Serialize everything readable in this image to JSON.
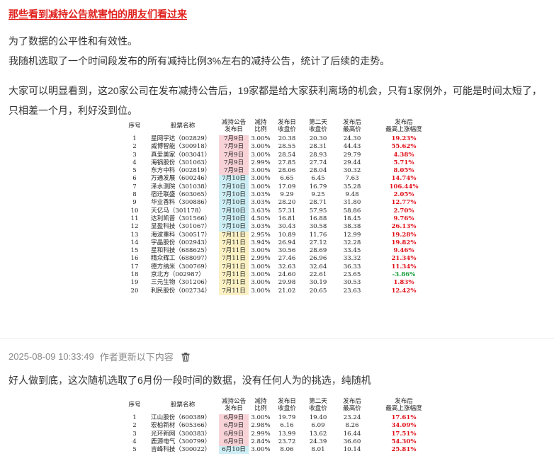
{
  "post": {
    "title": "那些看到减持公告就害怕的朋友们看过来",
    "p1": "为了数据的公平性和有效性。",
    "p2": "我随机选取了一个时间段发布的所有减持比例3%左右的减持公告，统计了后续的走势。",
    "p3": "大家可以明显看到，这20家公司在发布减持公告后，19家都是给大家获利离场的机会，只有1家例外，可能是时间太短了，只相差一个月，利好没到位。"
  },
  "table_headers": {
    "no": "序号",
    "name": "股票名称",
    "date_l1": "减持公告",
    "date_l2": "发布日",
    "ratio_l1": "减持",
    "ratio_l2": "比例",
    "close_l1": "发布日",
    "close_l2": "收盘价",
    "next_l1": "第二天",
    "next_l2": "收盘价",
    "high_l1": "发布后",
    "high_l2": "最高价",
    "pct_l1": "发布后",
    "pct_l2": "最高上涨幅度"
  },
  "table1": [
    {
      "no": "1",
      "name": "星网宇达（002829）",
      "date": "7月9日",
      "ratio": "3.00%",
      "close": "20.38",
      "next": "20.30",
      "high": "24.30",
      "pct": "19.23%",
      "bg": "pink",
      "sign": "pos"
    },
    {
      "no": "2",
      "name": "威博智能（300918）",
      "date": "7月9日",
      "ratio": "3.00%",
      "close": "28.55",
      "next": "28.31",
      "high": "44.43",
      "pct": "55.62%",
      "bg": "pink",
      "sign": "pos"
    },
    {
      "no": "3",
      "name": "真爱美家（003041）",
      "date": "7月9日",
      "ratio": "3.00%",
      "close": "28.54",
      "next": "28.93",
      "high": "29.79",
      "pct": "4.38%",
      "bg": "pink",
      "sign": "pos"
    },
    {
      "no": "4",
      "name": "海锅股份（301063）",
      "date": "7月9日",
      "ratio": "2.99%",
      "close": "27.85",
      "next": "27.74",
      "high": "29.44",
      "pct": "5.71%",
      "bg": "pink",
      "sign": "pos"
    },
    {
      "no": "5",
      "name": "东方中科（002819）",
      "date": "7月9日",
      "ratio": "3.00%",
      "close": "28.06",
      "next": "28.04",
      "high": "30.32",
      "pct": "8.05%",
      "bg": "pink",
      "sign": "pos"
    },
    {
      "no": "6",
      "name": "万通发展（600246）",
      "date": "7月10日",
      "ratio": "3.00%",
      "close": "6.65",
      "next": "6.45",
      "high": "7.63",
      "pct": "14.74%",
      "bg": "cyan",
      "sign": "pos"
    },
    {
      "no": "7",
      "name": "泽水测院（301038）",
      "date": "7月10日",
      "ratio": "3.00%",
      "close": "17.09",
      "next": "16.79",
      "high": "35.28",
      "pct": "106.44%",
      "bg": "cyan",
      "sign": "pos"
    },
    {
      "no": "8",
      "name": "宿迁联盛（603065）",
      "date": "7月10日",
      "ratio": "3.03%",
      "close": "9.29",
      "next": "9.25",
      "high": "9.48",
      "pct": "2.05%",
      "bg": "cyan",
      "sign": "pos"
    },
    {
      "no": "9",
      "name": "华业香料（300886）",
      "date": "7月10日",
      "ratio": "3.03%",
      "close": "28.20",
      "next": "28.71",
      "high": "31.80",
      "pct": "12.77%",
      "bg": "cyan",
      "sign": "pos"
    },
    {
      "no": "10",
      "name": "天亿马（301178）",
      "date": "7月10日",
      "ratio": "3.63%",
      "close": "57.31",
      "next": "57.95",
      "high": "58.86",
      "pct": "2.70%",
      "bg": "cyan",
      "sign": "pos"
    },
    {
      "no": "11",
      "name": "达利凯普（301566）",
      "date": "7月10日",
      "ratio": "4.50%",
      "close": "16.81",
      "next": "16.88",
      "high": "18.45",
      "pct": "9.76%",
      "bg": "cyan",
      "sign": "pos"
    },
    {
      "no": "12",
      "name": "显盈科技（301067）",
      "date": "7月10日",
      "ratio": "3.03%",
      "close": "30.43",
      "next": "30.58",
      "high": "38.38",
      "pct": "26.13%",
      "bg": "cyan",
      "sign": "pos"
    },
    {
      "no": "13",
      "name": "海波重科（300517）",
      "date": "7月11日",
      "ratio": "2.95%",
      "close": "10.89",
      "next": "11.76",
      "high": "12.99",
      "pct": "19.28%",
      "bg": "yellow",
      "sign": "pos"
    },
    {
      "no": "14",
      "name": "宇晶股份（002943）",
      "date": "7月11日",
      "ratio": "3.94%",
      "close": "26.94",
      "next": "27.12",
      "high": "32.28",
      "pct": "19.82%",
      "bg": "yellow",
      "sign": "pos"
    },
    {
      "no": "15",
      "name": "星和科技（688625）",
      "date": "7月11日",
      "ratio": "3.00%",
      "close": "30.56",
      "next": "28.69",
      "high": "33.45",
      "pct": "9.46%",
      "bg": "yellow",
      "sign": "pos"
    },
    {
      "no": "16",
      "name": "精众辉工（688097）",
      "date": "7月11日",
      "ratio": "2.99%",
      "close": "27.46",
      "next": "26.96",
      "high": "33.32",
      "pct": "21.34%",
      "bg": "yellow",
      "sign": "pos"
    },
    {
      "no": "17",
      "name": "德方纳米（300769）",
      "date": "7月11日",
      "ratio": "3.00%",
      "close": "32.63",
      "next": "32.64",
      "high": "36.33",
      "pct": "11.34%",
      "bg": "yellow",
      "sign": "pos"
    },
    {
      "no": "18",
      "name": "京北方（002987）",
      "date": "7月11日",
      "ratio": "3.00%",
      "close": "24.60",
      "next": "22.61",
      "high": "23.65",
      "pct": "-3.86%",
      "bg": "yellow",
      "sign": "neg"
    },
    {
      "no": "19",
      "name": "三元生物（301206）",
      "date": "7月11日",
      "ratio": "3.00%",
      "close": "29.98",
      "next": "30.19",
      "high": "30.53",
      "pct": "1.83%",
      "bg": "yellow",
      "sign": "pos"
    },
    {
      "no": "20",
      "name": "利民股份（002734）",
      "date": "7月11日",
      "ratio": "3.00%",
      "close": "21.02",
      "next": "20.65",
      "high": "23.63",
      "pct": "12.42%",
      "bg": "yellow",
      "sign": "pos"
    }
  ],
  "update": {
    "timestamp": "2025-08-09 10:33:49",
    "label": "作者更新以下内容",
    "text": "好人做到底，这次随机选取了6月份一段时间的数据，没有任何人为的挑选，纯随机"
  },
  "table2": [
    {
      "no": "1",
      "name": "江山股份（600389）",
      "date": "6月9日",
      "ratio": "3.00%",
      "close": "19.79",
      "next": "19.40",
      "high": "23.24",
      "pct": "17.61%",
      "bg": "pink",
      "sign": "pos"
    },
    {
      "no": "2",
      "name": "宏柏新材（605366）",
      "date": "6月9日",
      "ratio": "2.98%",
      "close": "6.16",
      "next": "6.09",
      "high": "8.26",
      "pct": "34.09%",
      "bg": "pink",
      "sign": "pos"
    },
    {
      "no": "3",
      "name": "光环新网（300383）",
      "date": "6月9日",
      "ratio": "2.99%",
      "close": "13.99",
      "next": "13.62",
      "high": "16.44",
      "pct": "17.51%",
      "bg": "pink",
      "sign": "pos"
    },
    {
      "no": "4",
      "name": "鹿源电气（300799）",
      "date": "6月9日",
      "ratio": "2.84%",
      "close": "23.72",
      "next": "24.39",
      "high": "36.60",
      "pct": "54.30%",
      "bg": "pink",
      "sign": "pos"
    },
    {
      "no": "5",
      "name": "吉峰科技（300022）",
      "date": "6月10日",
      "ratio": "3.00%",
      "close": "8.06",
      "next": "8.01",
      "high": "10.14",
      "pct": "25.81%",
      "bg": "cyan",
      "sign": "pos"
    }
  ]
}
